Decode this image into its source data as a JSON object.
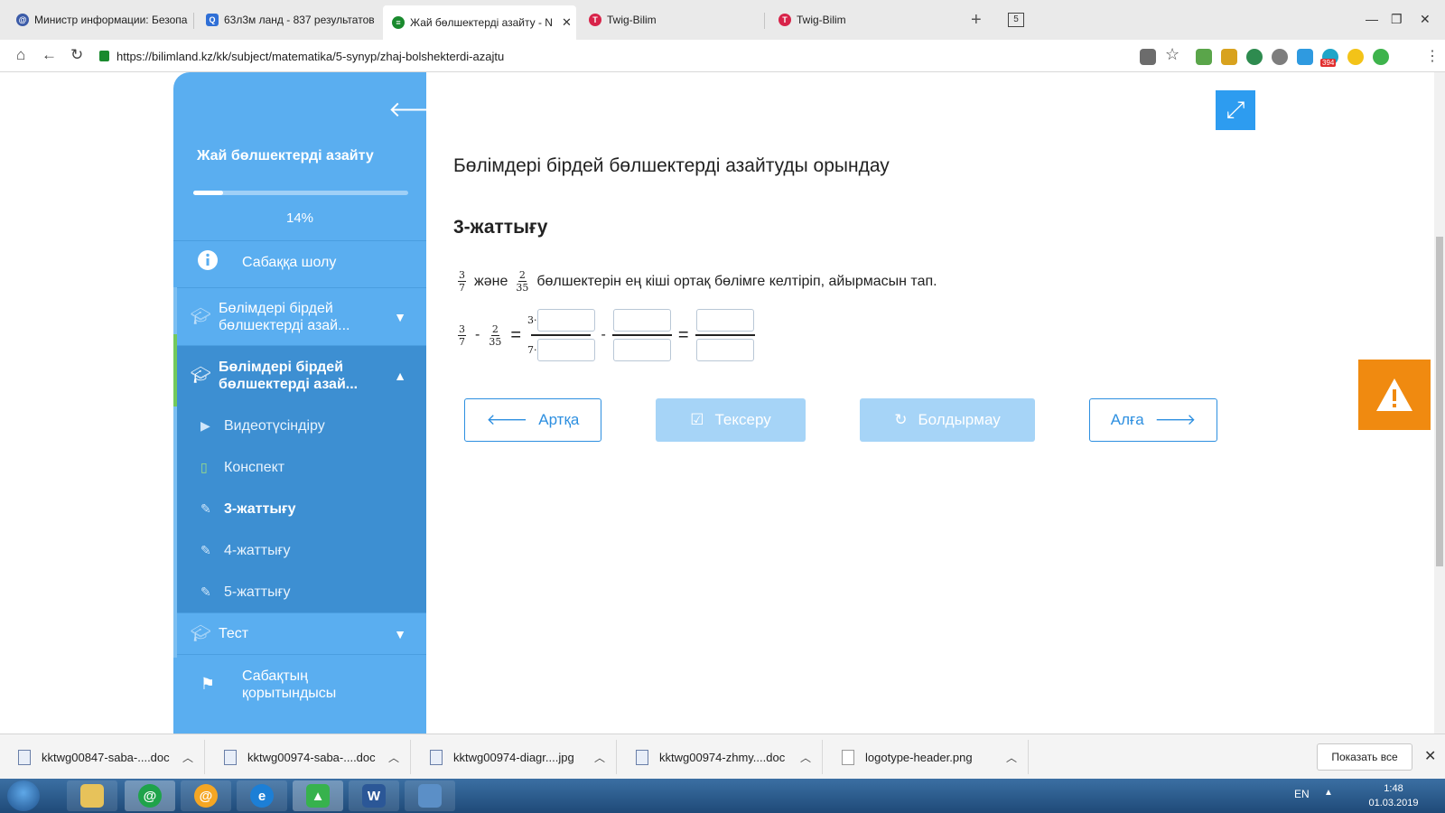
{
  "browser": {
    "tabs": [
      {
        "label": "Министр информации: Безопа",
        "favicon_color": "#3b5ba8"
      },
      {
        "label": "63л3м ланд - 837 результатов",
        "favicon_color": "#2f6fd6"
      },
      {
        "label": "Жай бөлшектерді азайту - N",
        "favicon_color": "#1a8a2e",
        "close": "✕"
      },
      {
        "label": "Twig-Bilim",
        "favicon_color": "#d8244a"
      },
      {
        "label": "Twig-Bilim",
        "favicon_color": "#d8244a"
      }
    ],
    "new_tab": "+",
    "tab_count": "5",
    "window_controls": {
      "minimize": "—",
      "restore": "❐",
      "close": "✕"
    },
    "url": "https://bilimland.kz/kk/subject/matematika/5-synyp/zhaj-bolshekterdi-azajtu",
    "download_badge": "394"
  },
  "sidebar": {
    "title": "Жай бөлшектерді азайту",
    "progress_fraction": 0.14,
    "progress_label": "14%",
    "overview_label": "Сабаққа шолу",
    "sections": [
      {
        "label": "Бөлімдері бірдей бөлшектерді азай..."
      },
      {
        "label": "Бөлімдері бірдей бөлшектерді азай..."
      }
    ],
    "sub_items": [
      {
        "label": "Видеотүсіндіру",
        "icon": "play-icon"
      },
      {
        "label": "Конспект",
        "icon": "book-icon"
      },
      {
        "label": "3-жаттығу",
        "icon": "edit-icon"
      },
      {
        "label": "4-жаттығу",
        "icon": "edit-icon"
      },
      {
        "label": "5-жаттығу",
        "icon": "edit-icon"
      }
    ],
    "test_label": "Тест",
    "summary_label": "Сабақтың қорытындысы"
  },
  "content": {
    "heading": "Бөлімдері бірдей бөлшектерді азайтуды орындау",
    "exercise": "3-жаттығу",
    "task": {
      "frac1": {
        "n": "3",
        "d": "7"
      },
      "conj": "және",
      "frac2": {
        "n": "2",
        "d": "35"
      },
      "text": "бөлшектерін ең кіші ортақ бөлімге келтіріп, айырмасын тап."
    },
    "equation": {
      "a": {
        "n": "3",
        "d": "7"
      },
      "minus": "-",
      "b": {
        "n": "2",
        "d": "35"
      },
      "equals": "=",
      "num_prefix": "3·",
      "den_prefix": "7·"
    },
    "buttons": {
      "back": "Артқа",
      "check": "Тексеру",
      "reset": "Болдырмау",
      "next": "Алға"
    }
  },
  "downloads": {
    "items": [
      "kktwg00847-saba-....doc",
      "kktwg00974-saba-....doc",
      "kktwg00974-diagr....jpg",
      "kktwg00974-zhmy....doc",
      "logotype-header.png"
    ],
    "show_all": "Показать все"
  },
  "taskbar": {
    "lang": "EN",
    "time": "1:48",
    "date": "01.03.2019"
  },
  "colors": {
    "sidebar": "#5aaef0",
    "sidebar_active": "#3d8fd2",
    "accent": "#2d8fe0",
    "disabled_button": "#a6d4f7",
    "warning": "#f08a10"
  }
}
